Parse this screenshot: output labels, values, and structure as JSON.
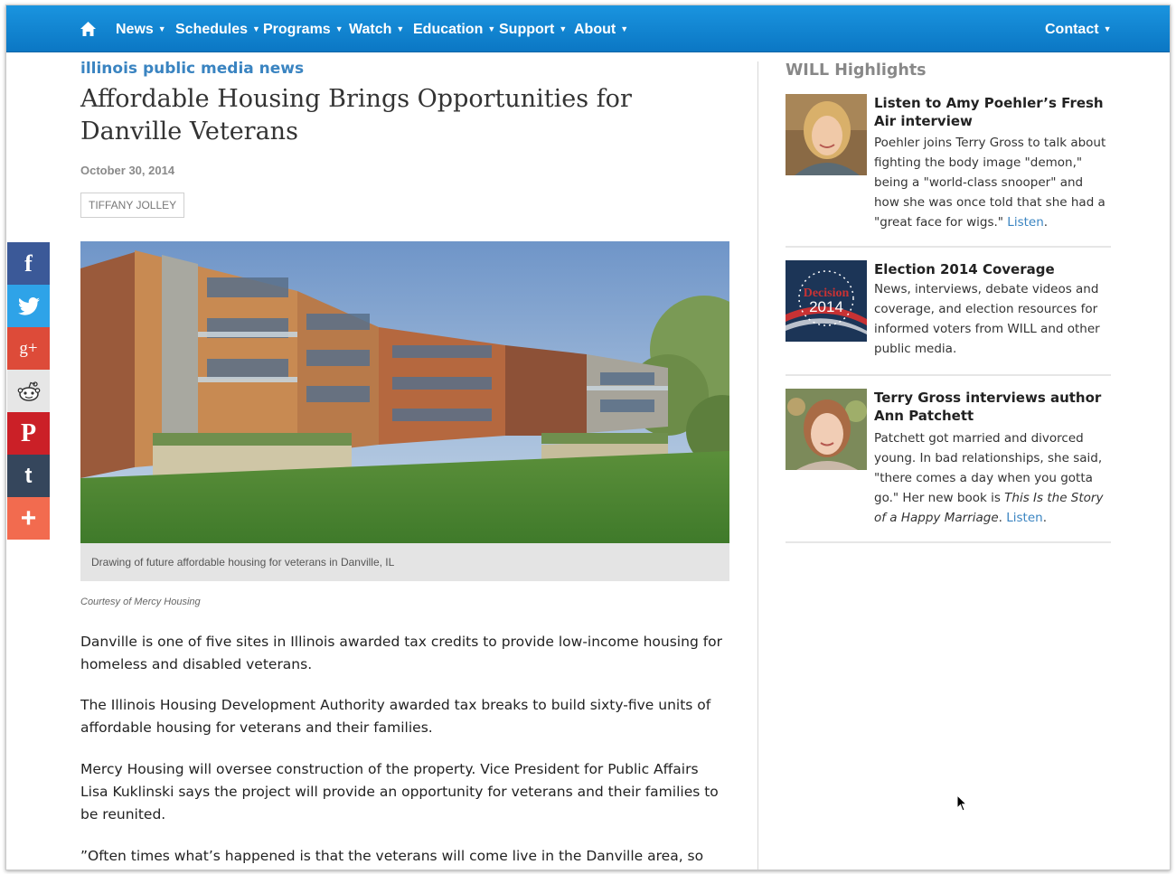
{
  "nav": {
    "home_icon": "home-icon",
    "items": [
      {
        "label": "News"
      },
      {
        "label": "Schedules"
      },
      {
        "label": "Programs"
      },
      {
        "label": "Watch"
      },
      {
        "label": "Education"
      },
      {
        "label": "Support"
      },
      {
        "label": "About"
      }
    ],
    "contact": "Contact",
    "colors": {
      "bar": "#0b80cc",
      "text": "#ffffff"
    }
  },
  "article": {
    "kicker": "illinois public media news",
    "headline": "Affordable Housing Brings Opportunities for Danville Veterans",
    "date": "October 30, 2014",
    "author": "TIFFANY JOLLEY",
    "image_caption": "Drawing of future affordable housing for veterans in Danville, IL",
    "credit": "Courtesy of Mercy Housing",
    "paragraphs": [
      "Danville is one of five sites in Illinois awarded tax credits to provide low-income housing for homeless and disabled veterans.",
      "The Illinois Housing Development Authority awarded tax breaks to build sixty-five units of affordable housing for veterans and their families.",
      "Mercy Housing will oversee construction of the property. Vice President for Public Affairs Lisa Kuklinski says the project will provide an opportunity for veterans and their families to be reunited.",
      "”Often times what’s happened is that the veterans will come live in the Danville area, so they"
    ]
  },
  "share": [
    {
      "icon": "facebook-icon",
      "glyph": "f",
      "color": "#3b5998"
    },
    {
      "icon": "twitter-icon",
      "glyph": "❧",
      "color": "#2ea3e8"
    },
    {
      "icon": "google-plus-icon",
      "glyph": "g+",
      "color": "#dd4b39"
    },
    {
      "icon": "reddit-icon",
      "glyph": "☺",
      "color": "#e3e3e3"
    },
    {
      "icon": "pinterest-icon",
      "glyph": "P",
      "color": "#cb2027"
    },
    {
      "icon": "tumblr-icon",
      "glyph": "t",
      "color": "#35465c"
    },
    {
      "icon": "more-icon",
      "glyph": "+",
      "color": "#f26b4f"
    }
  ],
  "sidebar": {
    "title": "WILL Highlights",
    "items": [
      {
        "title": "Listen to Amy Poehler’s Fresh Air interview",
        "text": "Poehler joins Terry Gross to talk about fighting the body image \"demon,\" being a \"world-class snooper\" and how she was once told that she had a \"great face for wigs.\"",
        "link": "Listen"
      },
      {
        "title": "Election 2014 Coverage",
        "text": "News, interviews, debate videos and coverage, and election resources for informed voters from WILL and other public media.",
        "thumb_text_top": "Decision",
        "thumb_text_bottom": "2014"
      },
      {
        "title": "Terry Gross interviews author Ann Patchett",
        "text_before": "Patchett got married and divorced young. In bad relationships, she said, \"there comes a day when you gotta go.\" Her new book is ",
        "italic": "This Is the Story of a Happy Marriage",
        "text_after": ". ",
        "link": "Listen"
      }
    ]
  }
}
